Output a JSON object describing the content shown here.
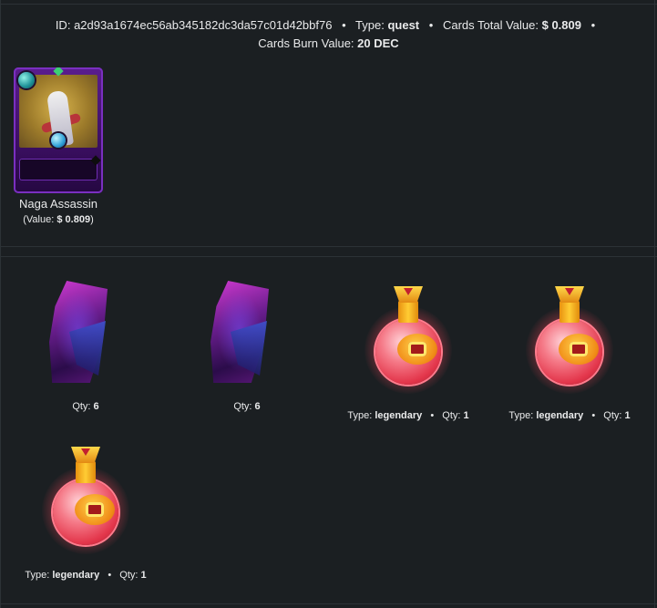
{
  "header": {
    "id_label": "ID:",
    "id_value": "a2d93a1674ec56ab345182dc3da57c01d42bbf76",
    "type_label": "Type:",
    "type_value": "quest",
    "total_label": "Cards Total Value:",
    "total_value": "$ 0.809",
    "burn_label": "Cards Burn Value:",
    "burn_value": "20 DEC",
    "separator": "•"
  },
  "card": {
    "name": "Naga Assassin",
    "value_label": "(Value:",
    "value": "$ 0.809",
    "value_close": ")"
  },
  "items": [
    {
      "kind": "shard",
      "qty_label": "Qty:",
      "qty": "6"
    },
    {
      "kind": "shard",
      "qty_label": "Qty:",
      "qty": "6"
    },
    {
      "kind": "potion",
      "type_label": "Type:",
      "type": "legendary",
      "qty_label": "Qty:",
      "qty": "1"
    },
    {
      "kind": "potion",
      "type_label": "Type:",
      "type": "legendary",
      "qty_label": "Qty:",
      "qty": "1"
    },
    {
      "kind": "potion",
      "type_label": "Type:",
      "type": "legendary",
      "qty_label": "Qty:",
      "qty": "1"
    }
  ],
  "colors": {
    "background": "#1b1f22",
    "divider": "#2c3236",
    "text": "#e9eaeb",
    "card_frame": "#5a1d8e",
    "potion": "#e3364b"
  }
}
